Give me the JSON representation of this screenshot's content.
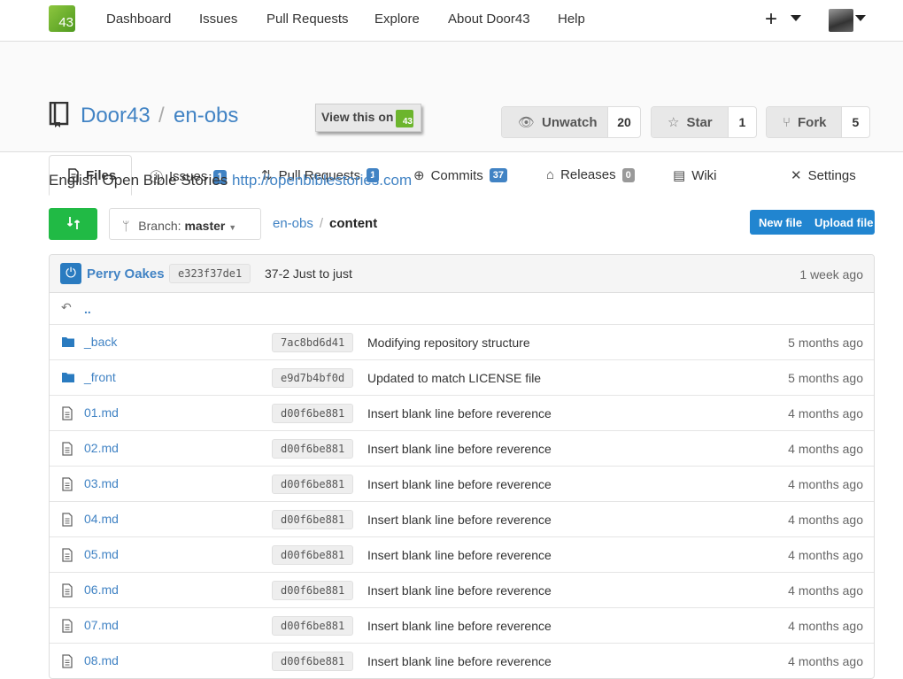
{
  "nav": {
    "logo_text": "43",
    "links": [
      "Dashboard",
      "Issues",
      "Pull Requests",
      "Explore",
      "About Door43",
      "Help"
    ],
    "plus": "+"
  },
  "repo": {
    "owner": "Door43",
    "separator": "/",
    "name": "en-obs",
    "view_on": "View this on",
    "view_on_logo": "43",
    "unwatch_label": "Unwatch",
    "watch_count": "20",
    "star_label": "Star",
    "star_count": "1",
    "fork_label": "Fork",
    "fork_count": "5"
  },
  "tabs": {
    "files": "Files",
    "issues": "Issues",
    "issues_count": "1",
    "pulls": "Pull Requests",
    "pulls_count": "1",
    "commits": "Commits",
    "commits_count": "37",
    "releases": "Releases",
    "releases_count": "0",
    "wiki": "Wiki",
    "settings": "Settings"
  },
  "description": {
    "text": "English Open Bible Stories",
    "link": "http://openbiblestories.com"
  },
  "toolbar": {
    "branch_prefix": "Branch:",
    "branch": "master",
    "path_root": "en-obs",
    "path_sep": "/",
    "path_current": "content",
    "new_file": "New file",
    "upload_file": "Upload file"
  },
  "latest_commit": {
    "author": "Perry Oakes",
    "sha": "e323f37de1",
    "message": "37-2 Just to just",
    "time": "1 week ago"
  },
  "parent_dir": "..",
  "files": [
    {
      "name": "_back",
      "type": "folder",
      "sha": "7ac8bd6d41",
      "message": "Modifying repository structure",
      "time": "5 months ago"
    },
    {
      "name": "_front",
      "type": "folder",
      "sha": "e9d7b4bf0d",
      "message": "Updated to match LICENSE file",
      "time": "5 months ago"
    },
    {
      "name": "01.md",
      "type": "file",
      "sha": "d00f6be881",
      "message": "Insert blank line before reverence",
      "time": "4 months ago"
    },
    {
      "name": "02.md",
      "type": "file",
      "sha": "d00f6be881",
      "message": "Insert blank line before reverence",
      "time": "4 months ago"
    },
    {
      "name": "03.md",
      "type": "file",
      "sha": "d00f6be881",
      "message": "Insert blank line before reverence",
      "time": "4 months ago"
    },
    {
      "name": "04.md",
      "type": "file",
      "sha": "d00f6be881",
      "message": "Insert blank line before reverence",
      "time": "4 months ago"
    },
    {
      "name": "05.md",
      "type": "file",
      "sha": "d00f6be881",
      "message": "Insert blank line before reverence",
      "time": "4 months ago"
    },
    {
      "name": "06.md",
      "type": "file",
      "sha": "d00f6be881",
      "message": "Insert blank line before reverence",
      "time": "4 months ago"
    },
    {
      "name": "07.md",
      "type": "file",
      "sha": "d00f6be881",
      "message": "Insert blank line before reverence",
      "time": "4 months ago"
    },
    {
      "name": "08.md",
      "type": "file",
      "sha": "d00f6be881",
      "message": "Insert blank line before reverence",
      "time": "4 months ago"
    }
  ],
  "colors": {
    "link": "#4183c4",
    "primary_button": "#2185d0",
    "compare_button": "#21ba45",
    "logo": "#6cb52d"
  },
  "icons": {
    "book": "book-icon",
    "folder": "folder-icon",
    "file": "file-text-icon",
    "back": "level-up-icon",
    "branch": "git-branch-icon",
    "compare": "compare-arrows-icon"
  }
}
